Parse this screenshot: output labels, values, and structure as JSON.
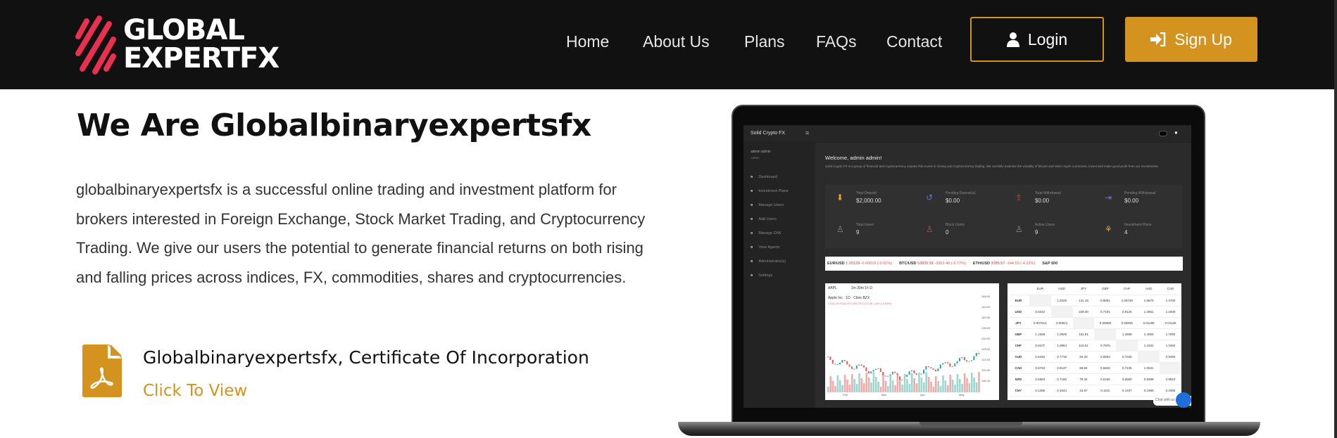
{
  "header": {
    "logo_line1": "GLOBAL",
    "logo_line2": "EXPERTFX",
    "nav": [
      "Home",
      "About Us",
      "Plans",
      "FAQs",
      "Contact"
    ],
    "login": "Login",
    "signup": "Sign Up",
    "accent": "#d4921f",
    "logo_color": "#e8314f"
  },
  "hero": {
    "title": "We Are Globalbinaryexpertsfx",
    "paragraph": "globalbinaryexpertsfx is a successful online trading and investment platform for brokers interested in Foreign Exchange, Stock Market Trading, and Cryptocurrency Trading. We give our users the potential to generate financial returns on both rising and falling prices across indices, FX, commodities, shares and cryptocurrencies.",
    "certificate_title": "Globalbinaryexpertsfx, Certificate Of Incorporation",
    "certificate_link": "Click To View"
  },
  "dashboard": {
    "brand": "Solid Crypto FX",
    "user": "admin admin",
    "role": "Admin",
    "sidebar": [
      "Dashboard",
      "Investment Plans",
      "Manage Users",
      "Add Users",
      "Manage D/W",
      "View Agents",
      "Administrator(s)",
      "Settings"
    ],
    "welcome": "Welcome, admin admin!",
    "intro": "Solid Crypto FX is a group of financial and cryptocurrency experts that invest in mining and cryptocurrency trading. We carefully examine the volatility of bitcoin and other crypto currencies, invest and make good profit from our investments.",
    "stats": [
      {
        "label": "Total Deposit",
        "value": "$2,000.00"
      },
      {
        "label": "Pending Deposit(s)",
        "value": "$0.00"
      },
      {
        "label": "Total Withdrawal",
        "value": "$0.00"
      },
      {
        "label": "Pending Withdrawal",
        "value": "$0.00"
      },
      {
        "label": "Total Users",
        "value": "9"
      },
      {
        "label": "Block Users",
        "value": "0"
      },
      {
        "label": "Active Users",
        "value": "9"
      },
      {
        "label": "Investment Plans",
        "value": "4"
      }
    ],
    "ticker": [
      {
        "pair": "EUR/USD",
        "price": "1.20129",
        "change": "-0.00016 (-0.01%)"
      },
      {
        "pair": "BTC/USD",
        "price": "53920.91",
        "change": "-3301.46 (-5.77%)"
      },
      {
        "pair": "ETH/USD",
        "price": "3285.57",
        "change": "-144.59 (-4.22%)"
      },
      {
        "pair": "S&P 500",
        "price": "",
        "change": ""
      }
    ],
    "chart": {
      "symbol": "AAPL",
      "intervals": "1m 30m 1h D",
      "title": "Apple Inc · 1D · Cboe BZX",
      "ohlc": "O131.19 H131.49 L126.70 C127.85 -4.69 (-3.54%)",
      "y_ticks": [
        "148.00",
        "144.00",
        "140.00",
        "136.00",
        "132.00",
        "128.00",
        "124.00",
        "120.00",
        "116.00"
      ],
      "x_ticks": [
        "Feb",
        "Mar",
        "Apr",
        "May"
      ],
      "last": "127.85"
    },
    "cross_rates": {
      "columns": [
        "EUR",
        "USD",
        "JPY",
        "GBP",
        "CHF",
        "AUD",
        "CAD"
      ],
      "rows": [
        [
          "EUR",
          "",
          "1.2029",
          "131.18",
          "0.8681",
          "1.09730",
          "1.5570",
          "1.4700"
        ],
        [
          "USD",
          "0.8322",
          "",
          "109.30",
          "0.7181",
          "0.9125",
          "1.2961",
          "1.2300"
        ],
        [
          "JPY",
          "0.007614",
          "0.00914",
          "",
          "0.00658",
          "0.00835",
          "0.01185",
          "0.01125"
        ],
        [
          "GBP",
          "1.1568",
          "1.3929",
          "151.81",
          "",
          "1.2658",
          "1.4093",
          "1.7092"
        ],
        [
          "CHF",
          "0.9107",
          "1.0964",
          "119.61",
          "0.7876",
          "",
          "1.4181",
          "1.3450"
        ],
        [
          "AUD",
          "0.6420",
          "0.7718",
          "84.33",
          "0.5553",
          "0.7040",
          "",
          "0.9490"
        ],
        [
          "CAD",
          "0.6763",
          "0.8137",
          "88.84",
          "0.5848",
          "0.7435",
          "1.0531",
          ""
        ],
        [
          "NZD",
          "0.5963",
          "0.7180",
          "78.34",
          "0.5159",
          "0.6560",
          "0.9289",
          "0.8810"
        ],
        [
          "CNY",
          "0.1285",
          "0.1544",
          "16.87",
          "0.1110",
          "0.1407",
          "0.1996",
          "0.1886"
        ]
      ]
    },
    "chat": "Chat with us"
  }
}
